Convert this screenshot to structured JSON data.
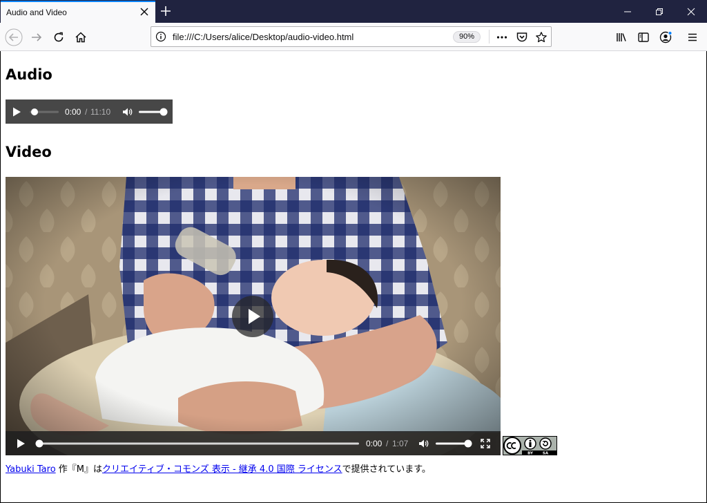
{
  "browser": {
    "tab_title": "Audio and Video",
    "url": "file:///C:/Users/alice/Desktop/audio-video.html",
    "zoom": "90%",
    "accent_color": "#0a84ff",
    "titlebar_color": "#202340"
  },
  "page": {
    "audio_heading": "Audio",
    "video_heading": "Video",
    "audio_player": {
      "current_time": "0:00",
      "separator": "/",
      "duration": "11:10",
      "progress": 0,
      "volume": 1.0
    },
    "video_player": {
      "current_time": "0:00",
      "separator": "/",
      "duration": "1:07",
      "progress": 0,
      "volume": 1.0
    },
    "license_badge": {
      "by_label": "BY",
      "sa_label": "SA"
    },
    "credit": {
      "author_link": "Yabuki Taro",
      "middle_text": " 作『M』は",
      "license_link": "クリエイティブ・コモンズ 表示 - 継承 4.0 国際 ライセンス",
      "suffix": "で提供されています。"
    }
  }
}
